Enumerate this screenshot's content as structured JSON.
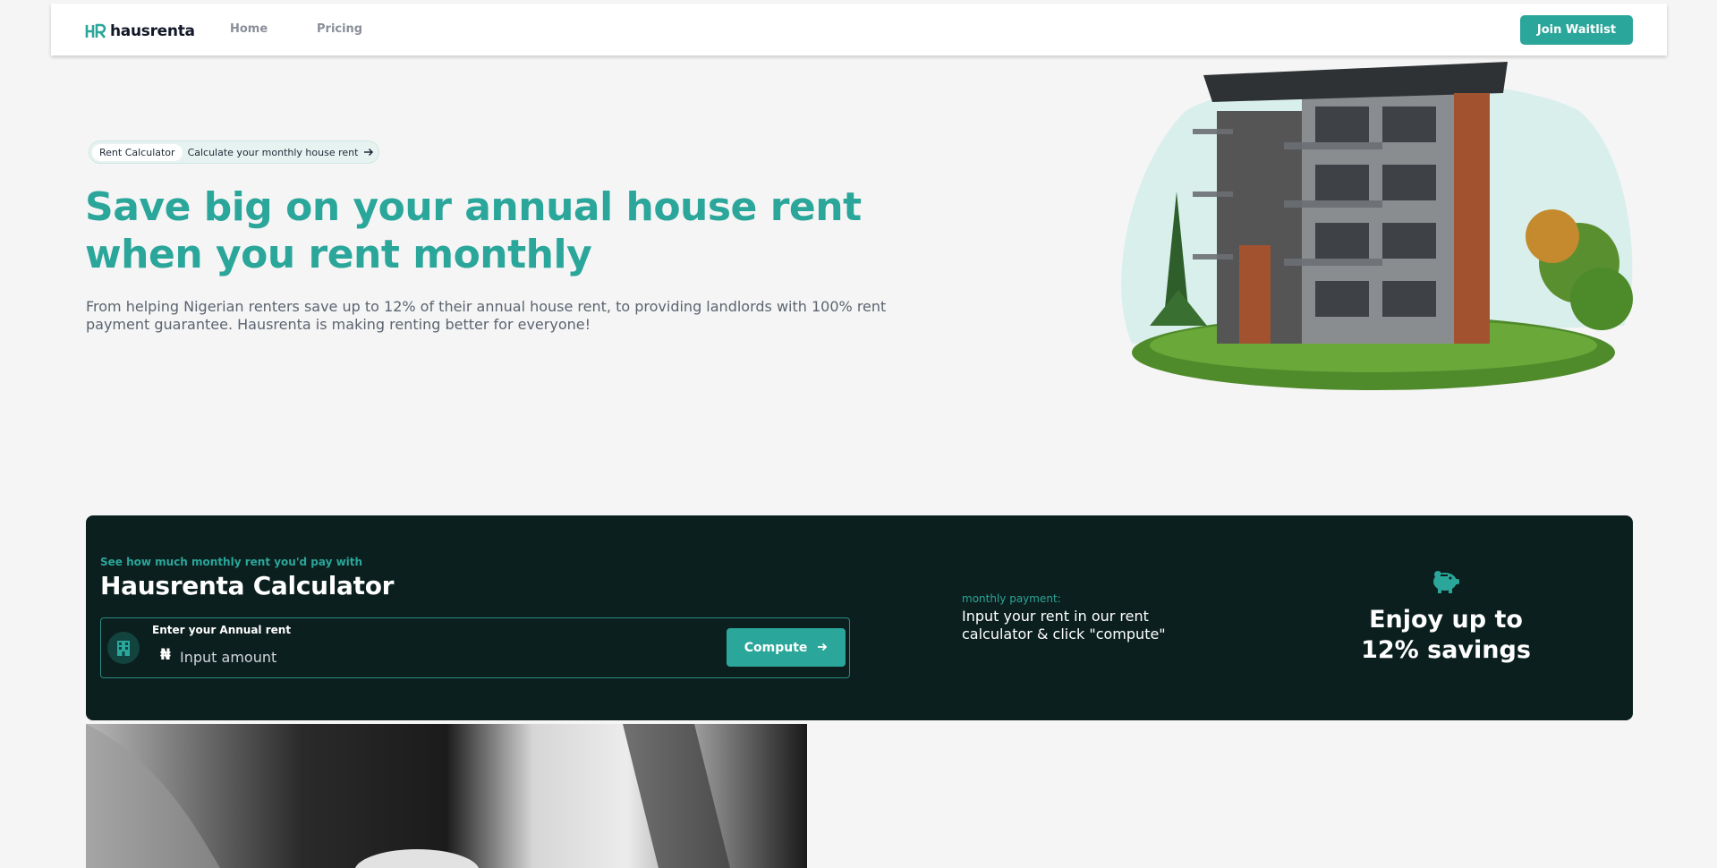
{
  "nav": {
    "brand": "hausrenta",
    "links": [
      {
        "label": "Home"
      },
      {
        "label": "Pricing"
      }
    ],
    "cta_label": "Join Waitlist"
  },
  "hero": {
    "pill_tag": "Rent Calculator",
    "pill_text": "Calculate your monthly house rent",
    "title": "Save big on your annual house rent when you rent monthly",
    "subtitle": "From helping Nigerian renters save up to 12% of their annual house rent, to providing landlords with 100% rent payment guarantee. Hausrenta is making renting better for everyone!"
  },
  "calculator": {
    "kicker": "See how much monthly rent you'd pay with",
    "title": "Hausrenta Calculator",
    "input_label": "Enter your Annual rent",
    "currency_symbol": "₦",
    "input_placeholder": "Input amount",
    "input_value": "",
    "compute_label": "Compute",
    "payment_label": "monthly payment:",
    "payment_text": "Input your rent in our rent calculator & click \"compute\"",
    "savings_text": "Enjoy up to 12% savings"
  },
  "colors": {
    "accent": "#2ba69a",
    "dark_band": "#0b1f1e",
    "background": "#f5f5f5"
  },
  "icons": [
    "logo-mark-icon",
    "arrow-right-icon",
    "building-icon",
    "piggy-bank-icon"
  ]
}
